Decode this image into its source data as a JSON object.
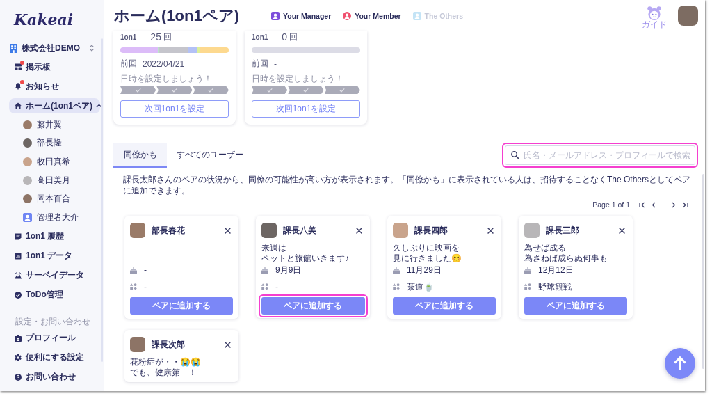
{
  "sidebar": {
    "logo": "Kakeai",
    "org": {
      "name": "株式会社DEMO"
    },
    "items": [
      {
        "label": "掲示板",
        "notification": true,
        "selected": false
      },
      {
        "label": "お知らせ",
        "notification": true,
        "selected": false
      },
      {
        "label": "ホーム(1on1ペア)",
        "notification": false,
        "selected": true,
        "expanded": true,
        "children": [
          {
            "label": "藤井翼",
            "kind": "photo",
            "selected": false
          },
          {
            "label": "部長隆",
            "kind": "photo",
            "selected": false
          },
          {
            "label": "牧田真希",
            "kind": "photo",
            "selected": false
          },
          {
            "label": "高田美月",
            "kind": "photo",
            "selected": false
          },
          {
            "label": "岡本百合",
            "kind": "photo",
            "selected": false
          },
          {
            "label": "管理者大介",
            "kind": "icon",
            "selected": false
          }
        ]
      },
      {
        "label": "1on1 履歴",
        "notification": false,
        "selected": false
      },
      {
        "label": "1on1 データ",
        "notification": false,
        "selected": false
      },
      {
        "label": "サーベイデータ",
        "notification": false,
        "selected": false
      },
      {
        "label": "ToDo管理",
        "notification": false,
        "selected": false
      }
    ],
    "section": {
      "title": "設定・お問い合わせ",
      "items": [
        {
          "label": "プロフィール"
        },
        {
          "label": "便利にする設定"
        },
        {
          "label": "お問い合わせ"
        }
      ]
    }
  },
  "header": {
    "title": "ホーム(1on1ペア)",
    "legend": [
      {
        "label": "Your Manager",
        "kind": "square",
        "color": "#7c4ddb",
        "active": true
      },
      {
        "label": "Your Member",
        "kind": "circle",
        "color": "#f0506e",
        "active": true
      },
      {
        "label": "The Others",
        "kind": "square",
        "color": "#c4e4f6",
        "active": false
      }
    ],
    "guide": "ガイド"
  },
  "pairs": [
    {
      "session_label": "1on1",
      "count": "25",
      "unit": "回",
      "segments": [
        {
          "color": "#dcbcf8"
        },
        {
          "color": "#b9e6c8"
        },
        {
          "color": "#c5c5cc"
        },
        {
          "color": "#b3c1f6"
        },
        {
          "color": "#dcef9a"
        },
        {
          "color": "#fdd98f"
        }
      ],
      "last_label": "前回",
      "last_value": "2022/04/21",
      "hint": "日時を設定しましょう！",
      "steps": [
        {
          "done": false
        },
        {
          "done": false
        },
        {
          "done": false
        }
      ],
      "button": "次回1on1を設定"
    },
    {
      "session_label": "1on1",
      "count": "0",
      "unit": "回",
      "last_label": "前回",
      "last_value": "-",
      "hint": "日時を設定しましょう！",
      "steps": [
        {
          "done": false
        },
        {
          "done": false
        },
        {
          "done": false
        }
      ],
      "button": "次回1on1を設定"
    }
  ],
  "tabs": [
    {
      "label": "同僚かも",
      "selected": true
    },
    {
      "label": "すべてのユーザー",
      "selected": false
    }
  ],
  "search": {
    "placeholder": "氏名・メールアドレス・プロフィールで検索",
    "highlighted": true
  },
  "description": "課長太郎さんのペアの状況から、同僚の可能性が高い方が表示されます。「同僚かも」に表示されている人は、招待することなくThe Othersとしてペアに追加できます。",
  "pagination": {
    "label": "Page 1 of 1"
  },
  "colleagues": [
    {
      "name": "部長春花",
      "birthday": "-",
      "hobby": "-",
      "button": "ペアに追加する",
      "highlighted": false
    },
    {
      "name": "課長八美",
      "message": [
        "来週は",
        "ペットと旅館いきます♪"
      ],
      "birthday": "9月9日",
      "hobby": "-",
      "button": "ペアに追加する",
      "highlighted": true
    },
    {
      "name": "課長四郎",
      "message": [
        "久しぶりに映画を",
        "見に行きました😊"
      ],
      "birthday": "11月29日",
      "hobby": "茶道🍵",
      "button": "ペアに追加する",
      "highlighted": false
    },
    {
      "name": "課長三郎",
      "message": [
        "為せば成る",
        "為さねば成らぬ何事も"
      ],
      "birthday": "12月12日",
      "hobby": "野球観戦",
      "button": "ペアに追加する",
      "highlighted": false
    },
    {
      "name": "課長次郎",
      "message": [
        "花粉症が・・😭😭",
        "でも、健康第一！"
      ]
    }
  ]
}
